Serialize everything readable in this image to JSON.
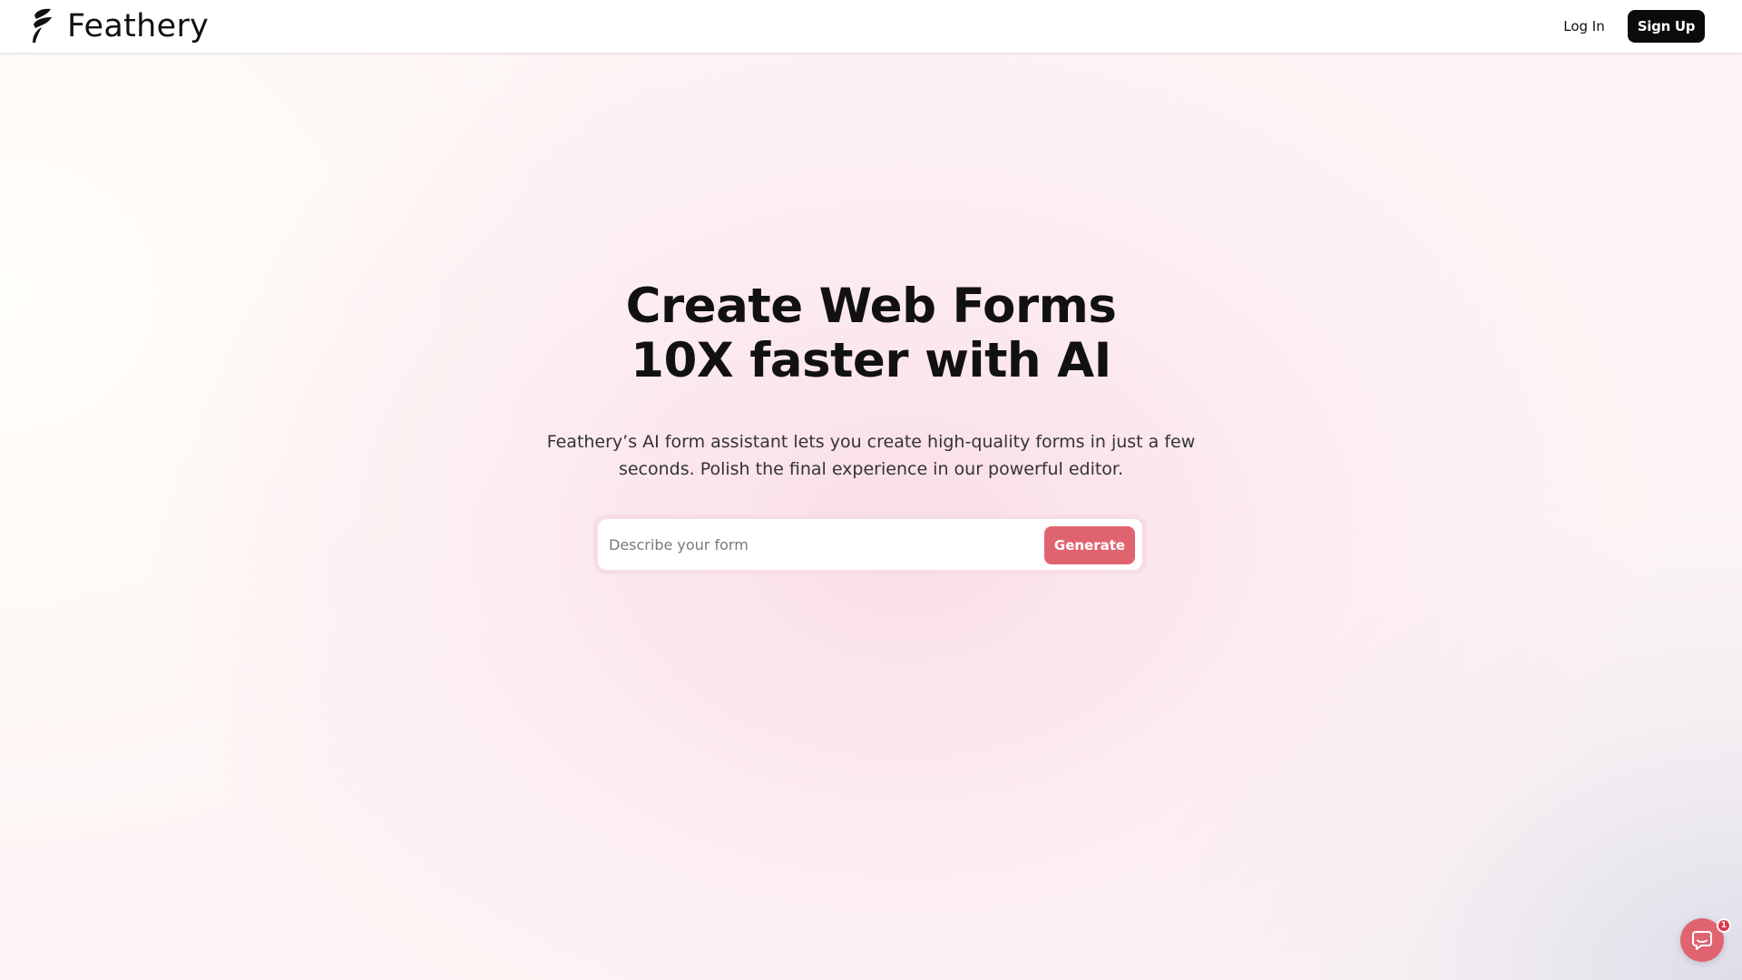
{
  "header": {
    "brand_name": "Feathery",
    "login_label": "Log In",
    "signup_label": "Sign Up"
  },
  "hero": {
    "title_line1": "Create Web Forms",
    "title_line2": "10X faster with AI",
    "subtitle_line1": "Feathery’s AI form assistant lets you create high-quality forms in just a few",
    "subtitle_line2": "seconds. Polish the final experience in our powerful editor."
  },
  "prompt": {
    "placeholder": "Describe your form",
    "value": "",
    "generate_label": "Generate"
  },
  "chat": {
    "badge_count": "1",
    "icon": "chat-bubble-icon"
  },
  "colors": {
    "accent": "#e06470",
    "button_dark": "#0b0b0b",
    "badge": "#e0364a"
  },
  "icons": {
    "logo": "feather-logo-icon"
  }
}
